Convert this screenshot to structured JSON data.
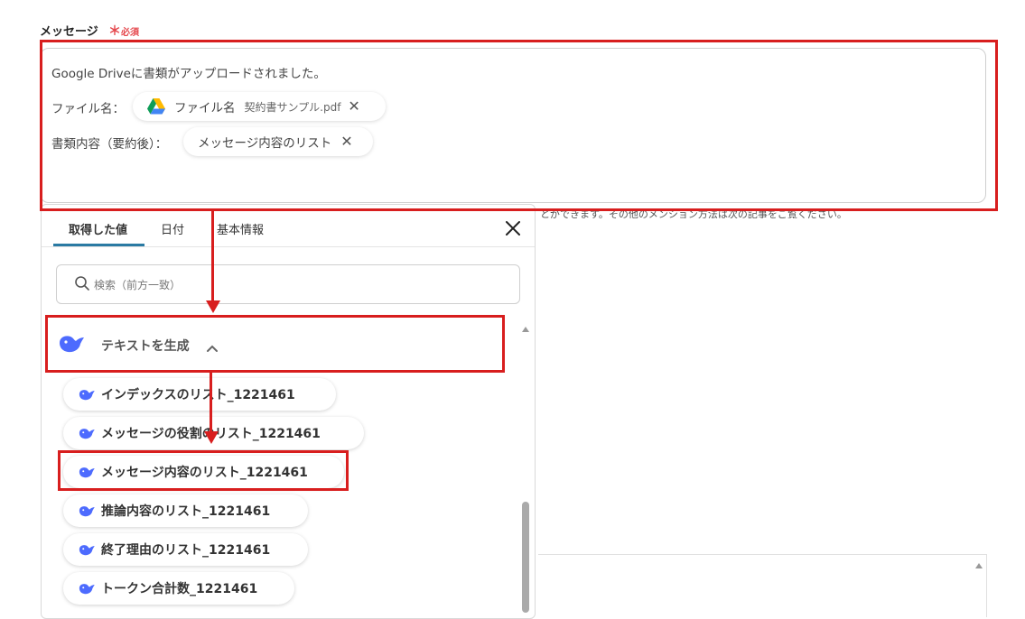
{
  "field": {
    "label": "メッセージ",
    "required_star": "＊",
    "required_text": "必須"
  },
  "message": {
    "line1": "Google Driveに書類がアップロードされました。",
    "line2_prefix": "ファイル名：",
    "line2_chip": {
      "icon": "google-drive-icon",
      "label": "ファイル名",
      "value": "契約書サンプル.pdf",
      "remove": "✕"
    },
    "line3_prefix": "書類内容（要約後）：",
    "line3_chip": {
      "label": "メッセージ内容のリスト",
      "remove": "✕"
    }
  },
  "background_hint": "とができます。その他のメンション方法は次の記事をご覧ください。",
  "panel": {
    "tabs": [
      {
        "label": "取得した値",
        "active": true
      },
      {
        "label": "日付",
        "active": false
      },
      {
        "label": "基本情報",
        "active": false
      }
    ],
    "close": "✕",
    "search_placeholder": "検索（前方一致）",
    "group": {
      "icon": "deepseek-whale-icon",
      "label": "テキストを生成",
      "toggle": "chevron-up-icon"
    },
    "items": [
      {
        "label": "インデックスのリスト_1221461"
      },
      {
        "label": "メッセージの役割のリスト_1221461"
      },
      {
        "label": "メッセージ内容のリスト_1221461"
      },
      {
        "label": "推論内容のリスト_1221461"
      },
      {
        "label": "終了理由のリスト_1221461"
      },
      {
        "label": "トークン合計数_1221461"
      }
    ]
  },
  "colors": {
    "annotation": "#d81e1e",
    "accent": "#2a7aa3",
    "required": "#e5484d"
  }
}
